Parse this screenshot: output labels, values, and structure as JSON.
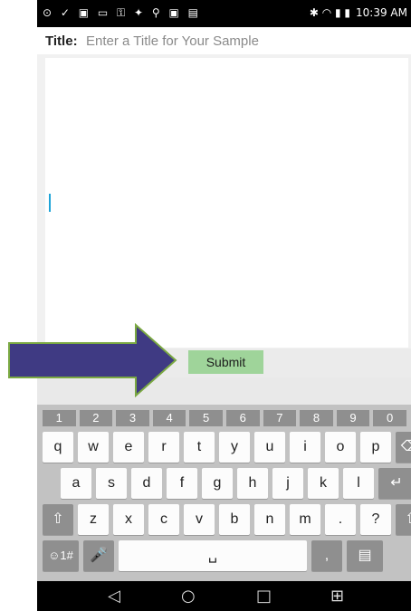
{
  "status_bar": {
    "left_icons": "⊙ ✓ ▣ ▭ ⚿ ✦ ⚲ ▣ ▤",
    "time": "10:39 AM",
    "right_icons": "✱ ◠ ▮ ▮"
  },
  "form": {
    "title_label": "Title:",
    "title_placeholder": "Enter a Title for Your Sample",
    "submit_label": "Submit"
  },
  "keyboard": {
    "numbers": [
      "1",
      "2",
      "3",
      "4",
      "5",
      "6",
      "7",
      "8",
      "9",
      "0"
    ],
    "row1": [
      "q",
      "w",
      "e",
      "r",
      "t",
      "y",
      "u",
      "i",
      "o",
      "p"
    ],
    "row2": [
      "a",
      "s",
      "d",
      "f",
      "g",
      "h",
      "j",
      "k",
      "l"
    ],
    "row3": [
      "z",
      "x",
      "c",
      "v",
      "b",
      "n",
      "m",
      ".",
      "?"
    ],
    "symbols_key": "☺1#",
    "comma_key": ","
  },
  "nav": {
    "back": "◁",
    "home": "○",
    "recents": "□",
    "menu": "⊞"
  },
  "colors": {
    "submit_bg": "#9fd49a",
    "arrow_fill": "#3f3a83",
    "arrow_border": "#7aa842",
    "caret": "#1ea4d8"
  }
}
